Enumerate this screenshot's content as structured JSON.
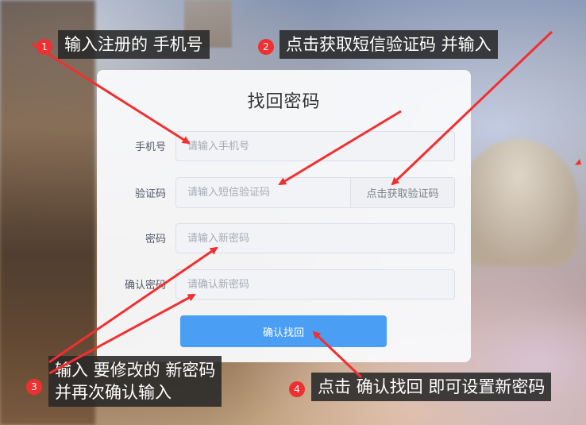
{
  "form": {
    "title": "找回密码",
    "phone": {
      "label": "手机号",
      "placeholder": "请输入手机号"
    },
    "code": {
      "label": "验证码",
      "placeholder": "请输入短信验证码",
      "button": "点击获取验证码"
    },
    "password": {
      "label": "密码",
      "placeholder": "请输入新密码"
    },
    "confirm": {
      "label": "确认密码",
      "placeholder": "请确认新密码"
    },
    "submit": "确认找回"
  },
  "callouts": [
    {
      "number": "1",
      "text": "输入注册的 手机号"
    },
    {
      "number": "2",
      "text": "点击获取短信验证码 并输入"
    },
    {
      "number": "3",
      "line1": "输入 要修改的 新密码",
      "line2": "并再次确认输入"
    },
    {
      "number": "4",
      "text": "点击 确认找回 即可设置新密码"
    }
  ],
  "colors": {
    "primary": "#4a9ff5",
    "annotation_red": "#f03030",
    "callout_bg": "#282828"
  }
}
